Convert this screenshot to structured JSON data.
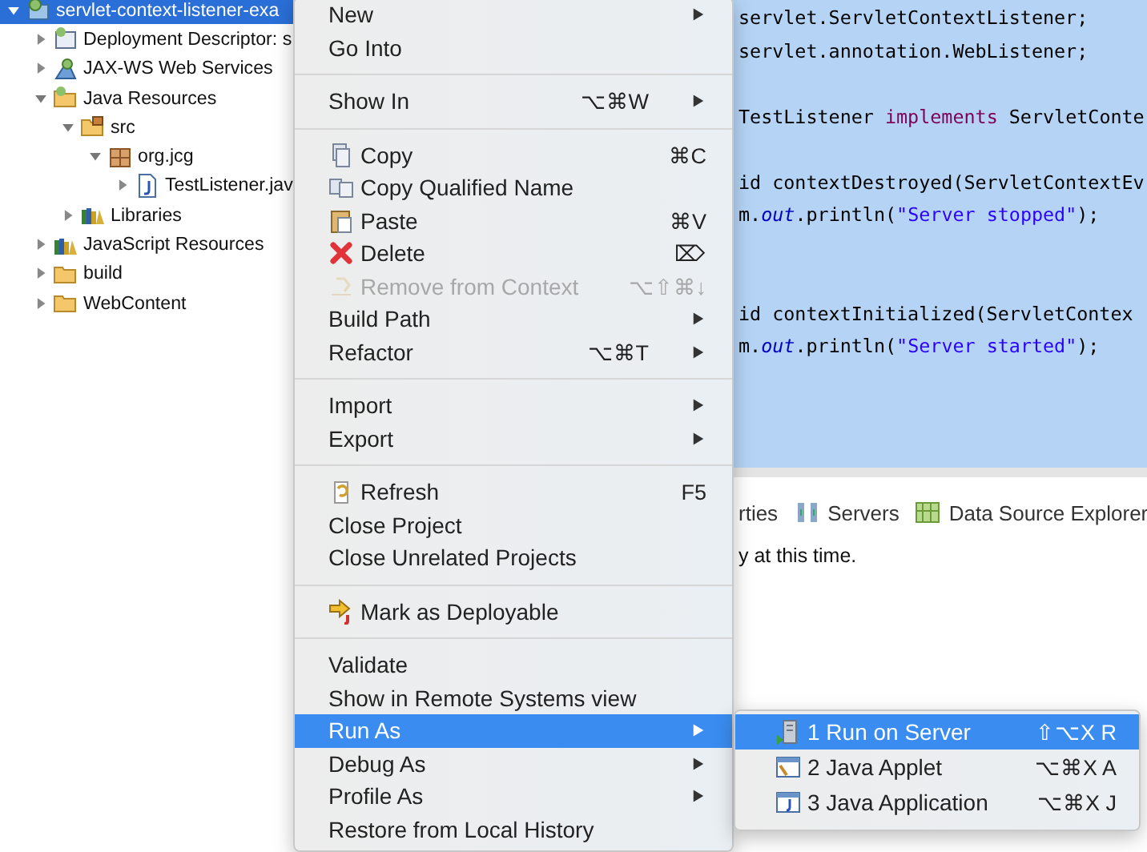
{
  "tree": {
    "items": [
      {
        "label": "servlet-context-listener-exa",
        "kind": "project",
        "expanded": true,
        "selected": true,
        "children": [
          {
            "label": "Deployment Descriptor: s",
            "kind": "descriptor",
            "expanded": false,
            "selected": false
          },
          {
            "label": "JAX-WS Web Services",
            "kind": "webservices",
            "expanded": false,
            "selected": false
          },
          {
            "label": "Java Resources",
            "kind": "java-resources",
            "expanded": true,
            "selected": false,
            "children": [
              {
                "label": "src",
                "kind": "source-folder",
                "expanded": true,
                "selected": false,
                "children": [
                  {
                    "label": "org.jcg",
                    "kind": "package",
                    "expanded": true,
                    "selected": false,
                    "children": [
                      {
                        "label": "TestListener.jav",
                        "kind": "java-file",
                        "expanded": false,
                        "selected": false
                      }
                    ]
                  }
                ]
              },
              {
                "label": "Libraries",
                "kind": "library",
                "expanded": false,
                "selected": false
              }
            ]
          },
          {
            "label": "JavaScript Resources",
            "kind": "library",
            "expanded": false,
            "selected": false
          },
          {
            "label": "build",
            "kind": "folder",
            "expanded": false,
            "selected": false
          },
          {
            "label": "WebContent",
            "kind": "folder",
            "expanded": false,
            "selected": false
          }
        ]
      }
    ]
  },
  "editor": {
    "lines": [
      {
        "kind": "code",
        "segments": [
          {
            "text": "servlet.ServletContextListener;",
            "kind": "plain"
          }
        ]
      },
      {
        "kind": "code",
        "segments": [
          {
            "text": "servlet.annotation.WebListener;",
            "kind": "plain"
          }
        ]
      },
      {
        "kind": "blank"
      },
      {
        "kind": "code",
        "segments": [
          {
            "text": "TestListener ",
            "kind": "plain"
          },
          {
            "text": "implements",
            "kind": "keyword"
          },
          {
            "text": " ServletConte",
            "kind": "plain"
          }
        ]
      },
      {
        "kind": "blank"
      },
      {
        "kind": "code",
        "segments": [
          {
            "text": "id contextDestroyed(ServletContextEv",
            "kind": "plain"
          }
        ]
      },
      {
        "kind": "code",
        "segments": [
          {
            "text": "m.",
            "kind": "plain"
          },
          {
            "text": "out",
            "kind": "field"
          },
          {
            "text": ".println(",
            "kind": "plain"
          },
          {
            "text": "\"Server stopped\"",
            "kind": "string"
          },
          {
            "text": ");",
            "kind": "plain"
          }
        ]
      },
      {
        "kind": "blank"
      },
      {
        "kind": "blank"
      },
      {
        "kind": "code",
        "segments": [
          {
            "text": "id contextInitialized(ServletContex",
            "kind": "plain"
          }
        ]
      },
      {
        "kind": "code",
        "segments": [
          {
            "text": "m.",
            "kind": "plain"
          },
          {
            "text": "out",
            "kind": "field"
          },
          {
            "text": ".println(",
            "kind": "plain"
          },
          {
            "text": "\"Server started\"",
            "kind": "string"
          },
          {
            "text": ");",
            "kind": "plain"
          }
        ]
      }
    ]
  },
  "bottom_panel": {
    "tabs": [
      {
        "label": "rties",
        "kind": "properties"
      },
      {
        "label": "Servers",
        "kind": "servers"
      },
      {
        "label": "Data Source Explorer",
        "kind": "data-source"
      }
    ],
    "message": "y at this time."
  },
  "context_menu": {
    "items": [
      {
        "kind": "item",
        "label": "New",
        "submenu": true,
        "disabled": false,
        "selected": false
      },
      {
        "kind": "item",
        "label": "Go Into",
        "submenu": false,
        "disabled": false,
        "selected": false
      },
      {
        "kind": "separator"
      },
      {
        "kind": "item",
        "label": "Show In",
        "shortcut": "⌥⌘W",
        "submenu": true,
        "disabled": false,
        "selected": false
      },
      {
        "kind": "separator"
      },
      {
        "kind": "item",
        "label": "Copy",
        "shortcut": "⌘C",
        "submenu": false,
        "disabled": false,
        "selected": false
      },
      {
        "kind": "item",
        "label": "Copy Qualified Name",
        "submenu": false,
        "disabled": false,
        "selected": false
      },
      {
        "kind": "item",
        "label": "Paste",
        "shortcut": "⌘V",
        "submenu": false,
        "disabled": false,
        "selected": false
      },
      {
        "kind": "item",
        "label": "Delete",
        "shortcut": "⌦",
        "submenu": false,
        "disabled": false,
        "selected": false
      },
      {
        "kind": "item",
        "label": "Remove from Context",
        "shortcut": "⌥⇧⌘↓",
        "submenu": false,
        "disabled": true,
        "selected": false
      },
      {
        "kind": "item",
        "label": "Build Path",
        "submenu": true,
        "disabled": false,
        "selected": false
      },
      {
        "kind": "item",
        "label": "Refactor",
        "shortcut": "⌥⌘T",
        "submenu": true,
        "disabled": false,
        "selected": false
      },
      {
        "kind": "separator"
      },
      {
        "kind": "item",
        "label": "Import",
        "submenu": true,
        "disabled": false,
        "selected": false
      },
      {
        "kind": "item",
        "label": "Export",
        "submenu": true,
        "disabled": false,
        "selected": false
      },
      {
        "kind": "separator"
      },
      {
        "kind": "item",
        "label": "Refresh",
        "shortcut": "F5",
        "submenu": false,
        "disabled": false,
        "selected": false
      },
      {
        "kind": "item",
        "label": "Close Project",
        "submenu": false,
        "disabled": false,
        "selected": false
      },
      {
        "kind": "item",
        "label": "Close Unrelated Projects",
        "submenu": false,
        "disabled": false,
        "selected": false
      },
      {
        "kind": "separator"
      },
      {
        "kind": "item",
        "label": "Mark as Deployable",
        "submenu": false,
        "disabled": false,
        "selected": false
      },
      {
        "kind": "separator"
      },
      {
        "kind": "item",
        "label": "Validate",
        "submenu": false,
        "disabled": false,
        "selected": false
      },
      {
        "kind": "item",
        "label": "Show in Remote Systems view",
        "submenu": false,
        "disabled": false,
        "selected": false
      },
      {
        "kind": "item",
        "label": "Run As",
        "submenu": true,
        "disabled": false,
        "selected": true
      },
      {
        "kind": "item",
        "label": "Debug As",
        "submenu": true,
        "disabled": false,
        "selected": false
      },
      {
        "kind": "item",
        "label": "Profile As",
        "submenu": true,
        "disabled": false,
        "selected": false
      },
      {
        "kind": "item",
        "label": "Restore from Local History",
        "submenu": false,
        "disabled": false,
        "selected": false
      }
    ]
  },
  "submenu": {
    "items": [
      {
        "kind": "item",
        "label": "1 Run on Server",
        "shortcut": "⇧⌥X R",
        "submenu": false,
        "disabled": false,
        "selected": true
      },
      {
        "kind": "item",
        "label": "2 Java Applet",
        "shortcut": "⌥⌘X A",
        "submenu": false,
        "disabled": false,
        "selected": false
      },
      {
        "kind": "item",
        "label": "3 Java Application",
        "shortcut": "⌥⌘X J",
        "submenu": false,
        "disabled": false,
        "selected": false
      }
    ]
  }
}
